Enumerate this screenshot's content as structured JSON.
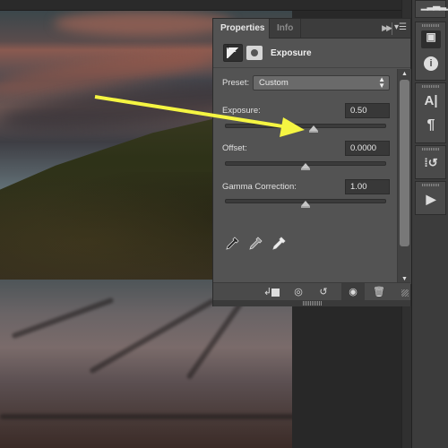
{
  "canvas": {
    "image_description": "Landscape photo: dramatic cloudy sky with pink highlights, grassy hillside, layered coastal rocks in foreground"
  },
  "annotation": {
    "arrow_color": "#f5f542",
    "arrow_points_to": "exposure-slider"
  },
  "panel": {
    "tabs": [
      {
        "label": "Properties",
        "active": true
      },
      {
        "label": "Info",
        "active": false
      }
    ],
    "collapse_icon": "double-chevron-right-icon",
    "menu_icon": "panel-menu-icon",
    "adjustment_title": "Exposure",
    "preset": {
      "label": "Preset:",
      "value": "Custom"
    },
    "controls": [
      {
        "label": "Exposure:",
        "value": "0.50",
        "slider_position": 0.55
      },
      {
        "label": "Offset:",
        "value": "0.0000",
        "slider_position": 0.5
      },
      {
        "label": "Gamma Correction:",
        "value": "1.00",
        "slider_position": 0.5
      }
    ],
    "eyedroppers": [
      "black-point-eyedropper-icon",
      "gray-point-eyedropper-icon",
      "white-point-eyedropper-icon"
    ],
    "footer_buttons": [
      {
        "name": "clip-to-layer-icon",
        "symbol": "↵■"
      },
      {
        "name": "view-previous-state-icon",
        "symbol": "👁↻"
      },
      {
        "name": "reset-icon",
        "symbol": "↺"
      },
      {
        "name": "toggle-visibility-icon",
        "symbol": "👁"
      },
      {
        "name": "delete-icon",
        "symbol": "🗑"
      }
    ]
  },
  "dock": {
    "icons": [
      "histogram-icon",
      "adjustments-icon",
      "info-icon",
      "character-icon",
      "paragraph-icon",
      "history-icon",
      "actions-play-icon"
    ],
    "char_label": "A|",
    "para_label": "¶",
    "info_label": "i",
    "play_label": "▶"
  }
}
